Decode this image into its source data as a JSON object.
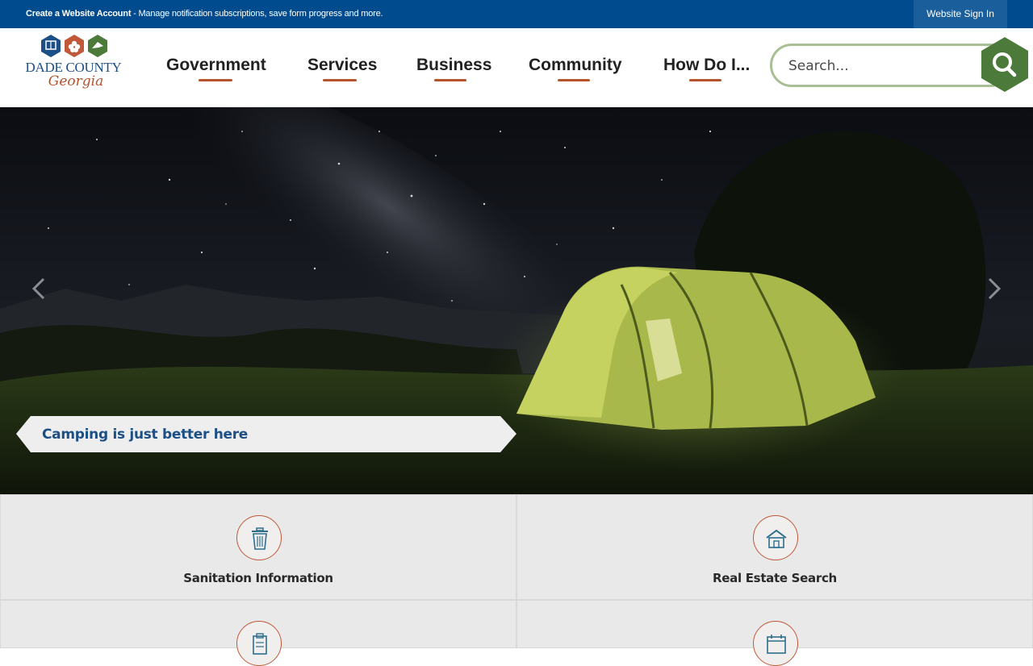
{
  "topbar": {
    "account_link": "Create a Website Account",
    "account_desc": " - Manage notification subscriptions, save form progress and more.",
    "signin_label": "Website Sign In"
  },
  "logo": {
    "name": "DADE COUNTY",
    "state": "Georgia"
  },
  "nav": {
    "items": [
      {
        "label": "Government"
      },
      {
        "label": "Services"
      },
      {
        "label": "Business"
      },
      {
        "label": "Community"
      },
      {
        "label": "How Do I..."
      }
    ]
  },
  "search": {
    "placeholder": "Search..."
  },
  "hero": {
    "caption": "Camping is just better here"
  },
  "tiles": [
    {
      "label": "Sanitation Information",
      "icon": "trash-can-icon"
    },
    {
      "label": "Real Estate Search",
      "icon": "house-icon"
    },
    {
      "label": "",
      "icon": "clipboard-icon"
    },
    {
      "label": "",
      "icon": "calendar-icon"
    }
  ],
  "colors": {
    "brand_blue": "#004b8d",
    "accent_orange": "#b5532d",
    "search_green": "#4b7a3a",
    "tile_bg": "#e9e9e9"
  }
}
